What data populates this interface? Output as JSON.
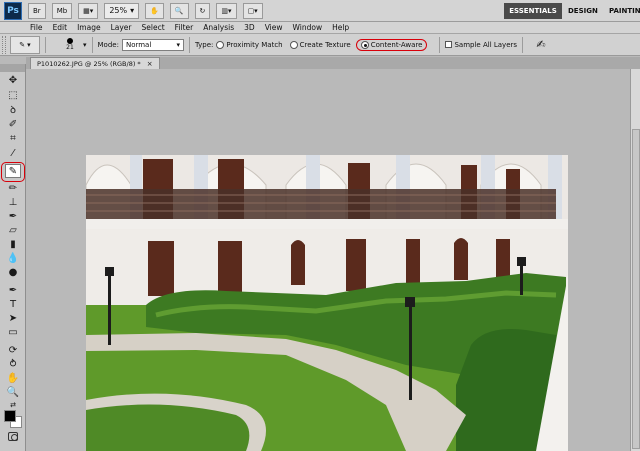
{
  "app": {
    "logo": "Ps",
    "bridge": "Br",
    "minibridge": "Mb",
    "zoom": "25%",
    "workspaces": [
      "ESSENTIALS",
      "DESIGN",
      "PAINTIN"
    ]
  },
  "menu": [
    "File",
    "Edit",
    "Image",
    "Layer",
    "Select",
    "Filter",
    "Analysis",
    "3D",
    "View",
    "Window",
    "Help"
  ],
  "options": {
    "brush_size": "21",
    "mode_label": "Mode:",
    "mode_value": "Normal",
    "type_label": "Type:",
    "type_options": [
      "Proximity Match",
      "Create Texture",
      "Content-Aware"
    ],
    "selected_type": "Content-Aware",
    "sample_all_layers": "Sample All Layers"
  },
  "document": {
    "tab_title": "P1010262.JPG @ 25% (RGB/8) *",
    "close": "×"
  },
  "colors": {
    "highlight": "#d8000a",
    "foreground": "#000000",
    "background": "#ffffff"
  },
  "tools": [
    "move-tool",
    "marquee-tool",
    "lasso-tool",
    "quick-selection-tool",
    "crop-tool",
    "eyedropper-tool",
    "spot-healing-brush-tool",
    "brush-tool",
    "clone-stamp-tool",
    "history-brush-tool",
    "eraser-tool",
    "gradient-tool",
    "blur-tool",
    "dodge-tool",
    "pen-tool",
    "type-tool",
    "path-selection-tool",
    "rectangle-tool",
    "3d-rotate-tool",
    "3d-orbit-tool",
    "hand-tool",
    "zoom-tool"
  ]
}
